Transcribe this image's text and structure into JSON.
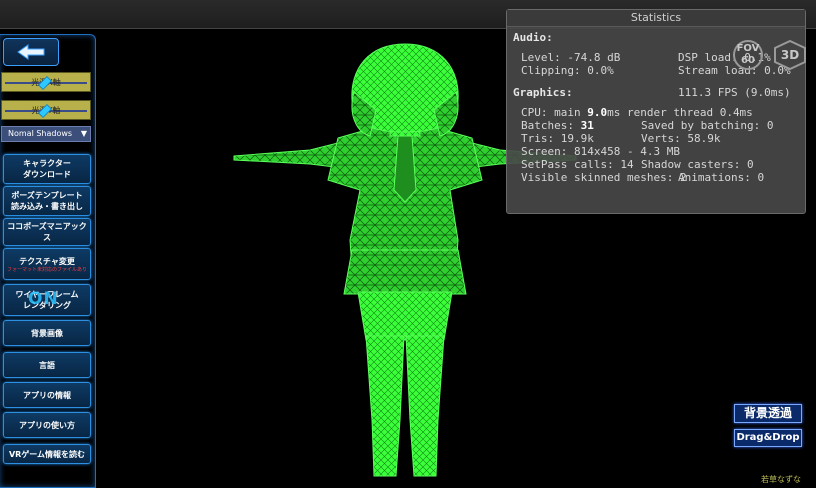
{
  "panel": {
    "slider1_label": "光源X軸",
    "slider2_label": "光源Y軸",
    "shadow_dropdown": "Nomal Shadows",
    "buttons": {
      "character_download": [
        "キャラクター",
        "ダウンロード"
      ],
      "pose_template": [
        "ポーズテンプレート",
        "読み込み・書き出し"
      ],
      "cocopose": "ココポーズマニアックス",
      "texture_change": "テクスチャ変更",
      "texture_warning": "フォーマット未対応のファイルあり",
      "wireframe": [
        "ワイヤーフレーム",
        "レンダリング"
      ],
      "wireframe_state": "ON",
      "background_image": "背景画像",
      "language": "言語",
      "app_info": "アプリの情報",
      "app_usage": "アプリの使い方",
      "vr_game": "VRゲーム情報を読む"
    }
  },
  "stats": {
    "title": "Statistics",
    "audio_header": "Audio:",
    "level": "Level: -74.8 dB",
    "dsp": "DSP load: 0.1%",
    "clipping": "Clipping: 0.0%",
    "stream": "Stream load: 0.0%",
    "graphics_header": "Graphics:",
    "fps": "111.3 FPS (9.0ms)",
    "cpu_prefix": "CPU: main ",
    "cpu_main": "9.0",
    "cpu_suffix": "ms  render thread 0.4ms",
    "batches_prefix": "Batches: ",
    "batches": "31",
    "saved": "Saved by batching: 0",
    "tris": "Tris: 19.9k",
    "verts": "Verts: 58.9k",
    "screen": "Screen: 814x458 - 4.3 MB",
    "setpass": "SetPass calls: 14",
    "shadow_casters": "Shadow casters: 0",
    "skinned": "Visible skinned meshes: 2",
    "animations": "Animations: 0"
  },
  "view": {
    "fov_label": "FOV",
    "fov_value": "60",
    "mode_3d": "3D"
  },
  "bottom": {
    "bg_transparent": "背景透過",
    "drag_drop": "Drag&Drop",
    "credit": "若草なずな"
  },
  "colors": {
    "wire": "#39ff39",
    "wire_dark": "#1a8a1a",
    "accent_blue": "#2c8fe0"
  }
}
